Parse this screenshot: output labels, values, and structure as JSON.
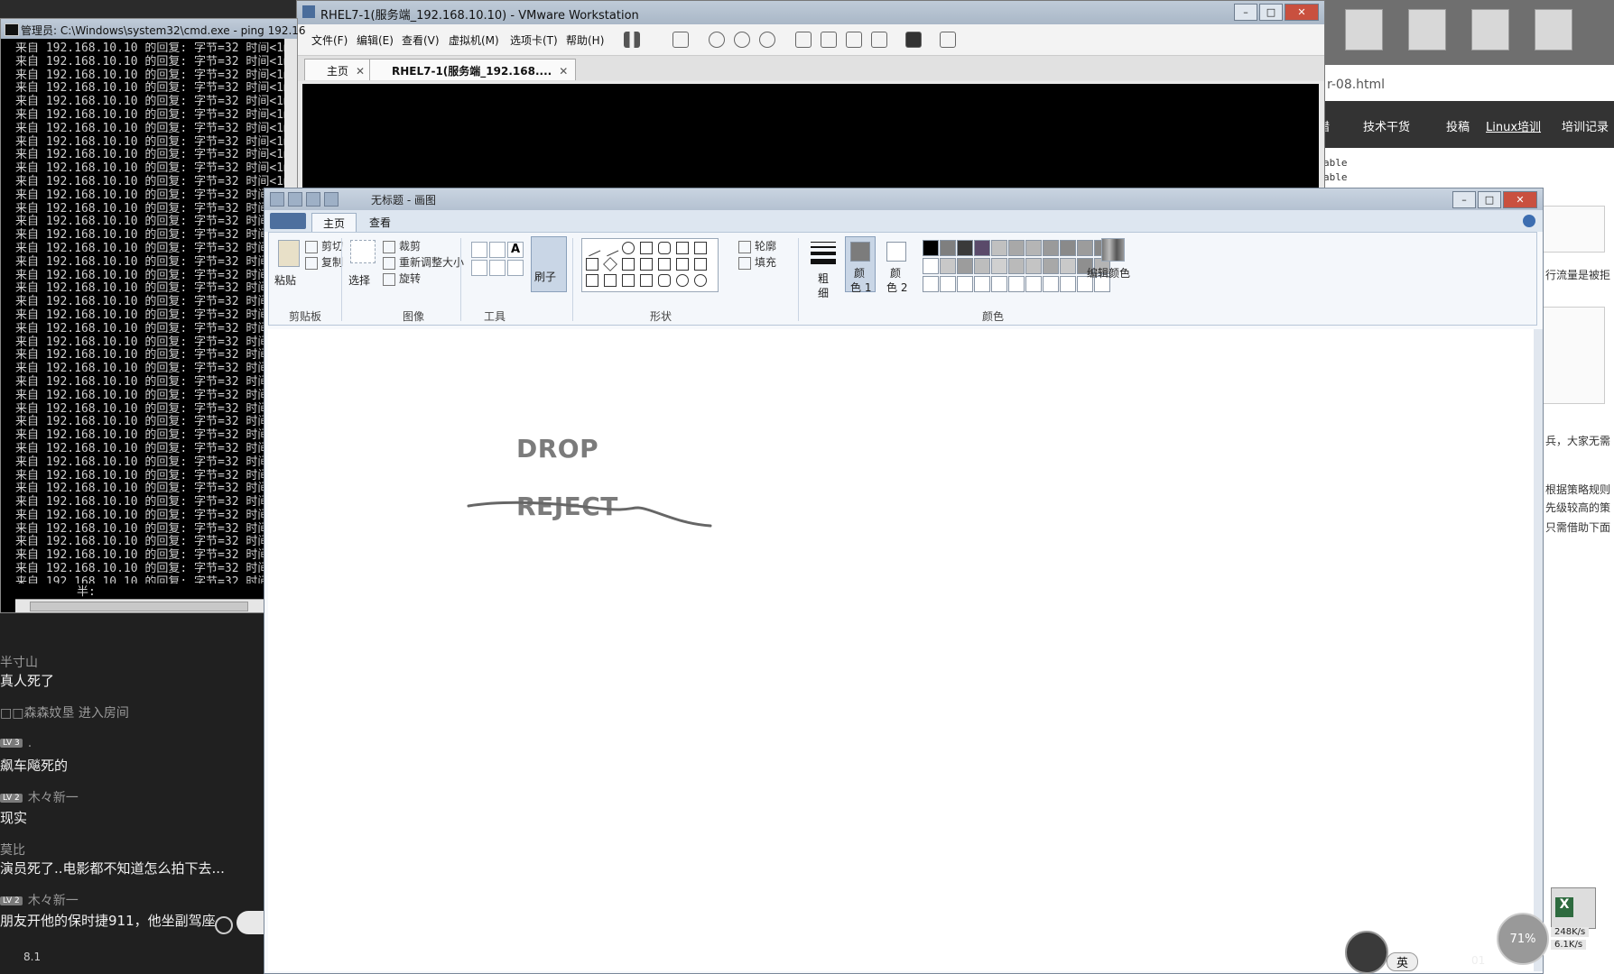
{
  "cmd": {
    "title": "管理员: C:\\Windows\\system32\\cmd.exe - ping  192.16",
    "line": "来自 192.168.10.10 的回复: 字节=32 时间<1ms",
    "line_count": 41,
    "prompt": "半:"
  },
  "vmware": {
    "title": "RHEL7-1(服务端_192.168.10.10) - VMware Workstation",
    "menus": [
      "文件(F)",
      "编辑(E)",
      "查看(V)",
      "虚拟机(M)",
      "选项卡(T)",
      "帮助(H)"
    ],
    "tabs": [
      {
        "label": "主页"
      },
      {
        "label": "RHEL7-1(服务端_192.168...."
      }
    ]
  },
  "browser": {
    "url": "r-08.html",
    "nav": [
      "错",
      "技术干货",
      "投稿",
      "Linux培训",
      "培训记录"
    ],
    "code": [
      "able",
      "able"
    ],
    "side": [
      "行流量是被拒",
      "兵，大家无需",
      "根据策略规则",
      "先级较高的策",
      "只需借助下面"
    ]
  },
  "paint": {
    "title": "无标题 - 画图",
    "tabs": [
      "主页",
      "查看"
    ],
    "groups": {
      "clipboard": "剪贴板",
      "image": "图像",
      "tools": "工具",
      "shapes": "形状",
      "colors": "颜色"
    },
    "buttons": {
      "paste": "粘贴",
      "cut": "剪切",
      "copy": "复制",
      "select": "选择",
      "crop": "裁剪",
      "resize": "重新调整大小",
      "rotate": "旋转",
      "brushes": "刷子",
      "outline": "轮廓",
      "fill": "填充",
      "size_top": "粗",
      "size_bottom": "细",
      "color1_top": "颜",
      "color1_bottom": "色 1",
      "color2_top": "颜",
      "color2_bottom": "色 2",
      "edit_colors": "编辑颜色"
    },
    "palette_row1": [
      "#000000",
      "#7f7f7f",
      "#3a3a3a",
      "#5a4a6a",
      "#c0c0c0",
      "#a8a8a8",
      "#b5b5b5",
      "#9a9a9a",
      "#8a8a8a",
      "#9c9c9c",
      "#888888"
    ],
    "palette_row2": [
      "#ffffff",
      "#c8c8c8",
      "#9c9c9c",
      "#bdbdbd",
      "#d0d0d0",
      "#bababa",
      "#c4c4c4",
      "#a8a8a8",
      "#c9c9c9",
      "#8f8f8f",
      "#b4b4b4"
    ],
    "canvas": {
      "text1": "DROP",
      "text2": "REJECT"
    }
  },
  "chat": {
    "messages": [
      {
        "name": "半寸山",
        "text": "真人死了"
      },
      {
        "system": "□□森森妏垦 进入房间"
      },
      {
        "badge": "LV 3",
        "name": ".",
        "text": "飙车飚死的"
      },
      {
        "badge": "LV 2",
        "name": "木々新一",
        "text": "现实"
      },
      {
        "name": "莫比",
        "text": "演员死了..电影都不知道怎么拍下去..."
      },
      {
        "badge": "LV 2",
        "name": "木々新一",
        "text": "朋友开他的保时捷911，他坐副驾座"
      }
    ],
    "footer": "8.1"
  },
  "tray": {
    "ime": "英",
    "time": "01",
    "net_percent": "71%",
    "up": "248K/s",
    "down": "6.1K/s"
  }
}
